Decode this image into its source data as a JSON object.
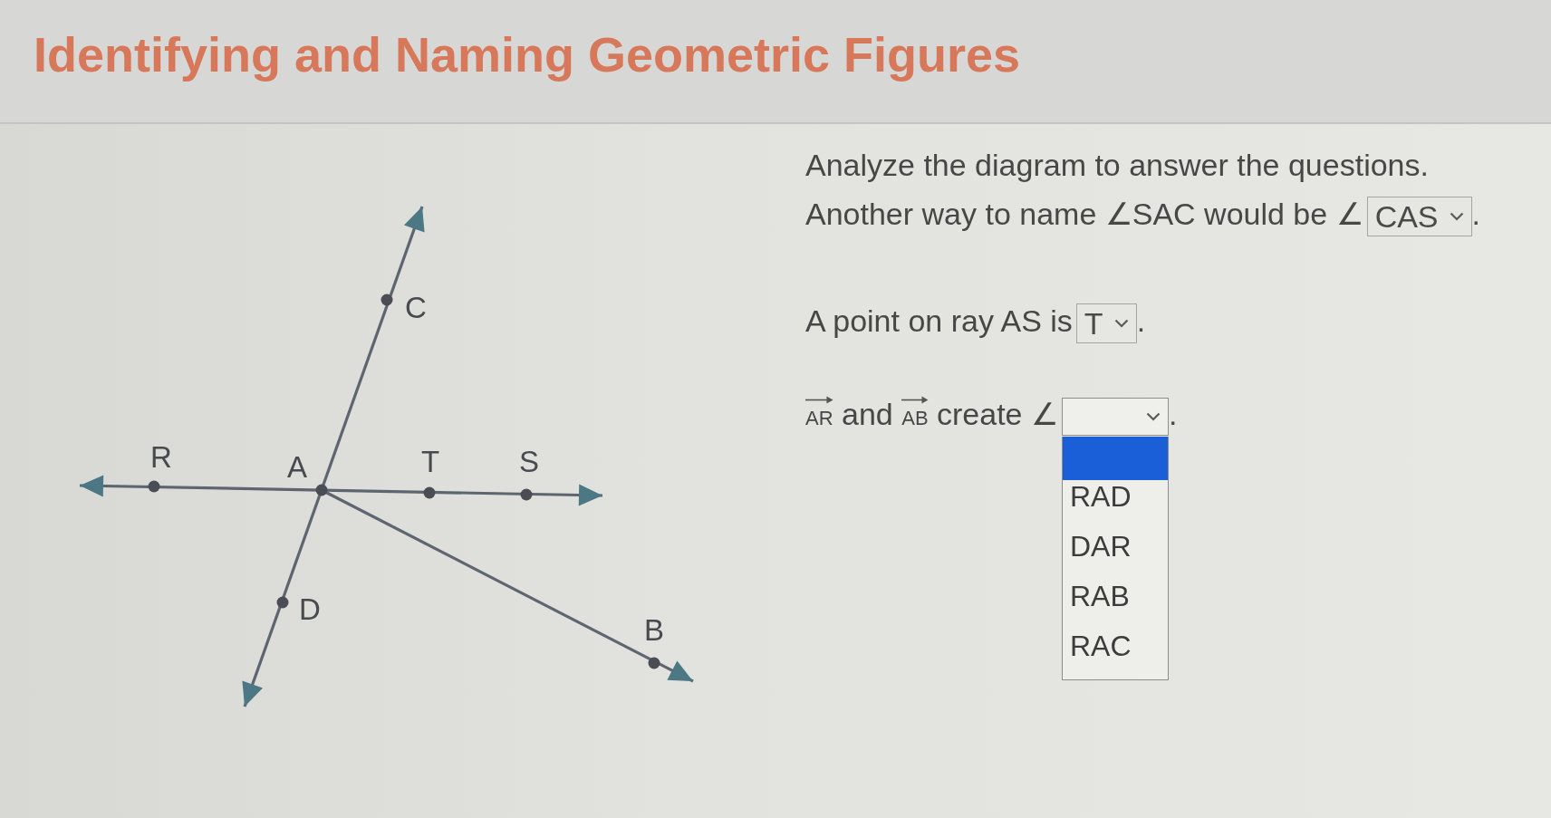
{
  "header": {
    "title": "Identifying and Naming Geometric Figures"
  },
  "diagram": {
    "points": [
      {
        "label": "C"
      },
      {
        "label": "R"
      },
      {
        "label": "A"
      },
      {
        "label": "T"
      },
      {
        "label": "S"
      },
      {
        "label": "D"
      },
      {
        "label": "B"
      }
    ]
  },
  "instructions": "Analyze the diagram to answer the questions.",
  "questions": [
    {
      "parts": [
        {
          "kind": "text",
          "text": "Another way to name ∠SAC would be ∠"
        },
        {
          "kind": "dropdown",
          "value": "CAS",
          "open": false
        },
        {
          "kind": "text",
          "text": "."
        }
      ]
    },
    {
      "parts": [
        {
          "kind": "text",
          "text": "A point on ray AS is"
        },
        {
          "kind": "dropdown",
          "value": "T",
          "open": false
        },
        {
          "kind": "text",
          "text": "."
        }
      ]
    },
    {
      "parts": [
        {
          "kind": "ray",
          "text": "AR"
        },
        {
          "kind": "text",
          "text": "and"
        },
        {
          "kind": "ray",
          "text": "AB"
        },
        {
          "kind": "text",
          "text": "create ∠"
        },
        {
          "kind": "dropdown",
          "open": true,
          "options": [
            {
              "kind": "blank",
              "selected": true
            },
            {
              "kind": "option",
              "label": "RAD",
              "selected": false
            },
            {
              "kind": "option",
              "label": "DAR",
              "selected": false
            },
            {
              "kind": "option",
              "label": "RAB",
              "selected": false
            },
            {
              "kind": "option",
              "label": "RAC",
              "selected": false
            }
          ]
        },
        {
          "kind": "text",
          "text": "."
        }
      ]
    }
  ]
}
